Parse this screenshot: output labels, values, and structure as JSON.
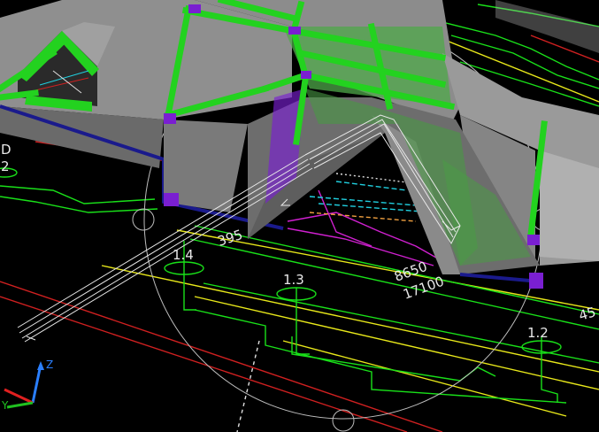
{
  "viewport": {
    "background": "#000000",
    "edge_labels": {
      "left_top": "D",
      "left_mid": "2"
    }
  },
  "grid_bubbles": [
    {
      "label": "1.4"
    },
    {
      "label": "1.3"
    },
    {
      "label": "1.2"
    }
  ],
  "dimensions": [
    {
      "label": "395"
    },
    {
      "label": "8650"
    },
    {
      "label": "17100"
    },
    {
      "label": "45"
    }
  ],
  "ucs_icon": {
    "x_color": "#e02020",
    "y_color": "#20c020",
    "z_color": "#2a7fff",
    "z_label": "Z",
    "y_label": "Y"
  },
  "colors": {
    "roof": "#8c8c8c",
    "roof_dark": "#5e5e5e",
    "structure": "#23d21f",
    "steel_connector": "#7a1fd1",
    "gutter": "#1a1a8c",
    "linework_green": "#19e019",
    "linework_yellow": "#e8e81a",
    "linework_red": "#d02020",
    "linework_magenta": "#d020d0",
    "linework_cyan": "#20d0e0",
    "orbit": "#bdbdbd"
  }
}
